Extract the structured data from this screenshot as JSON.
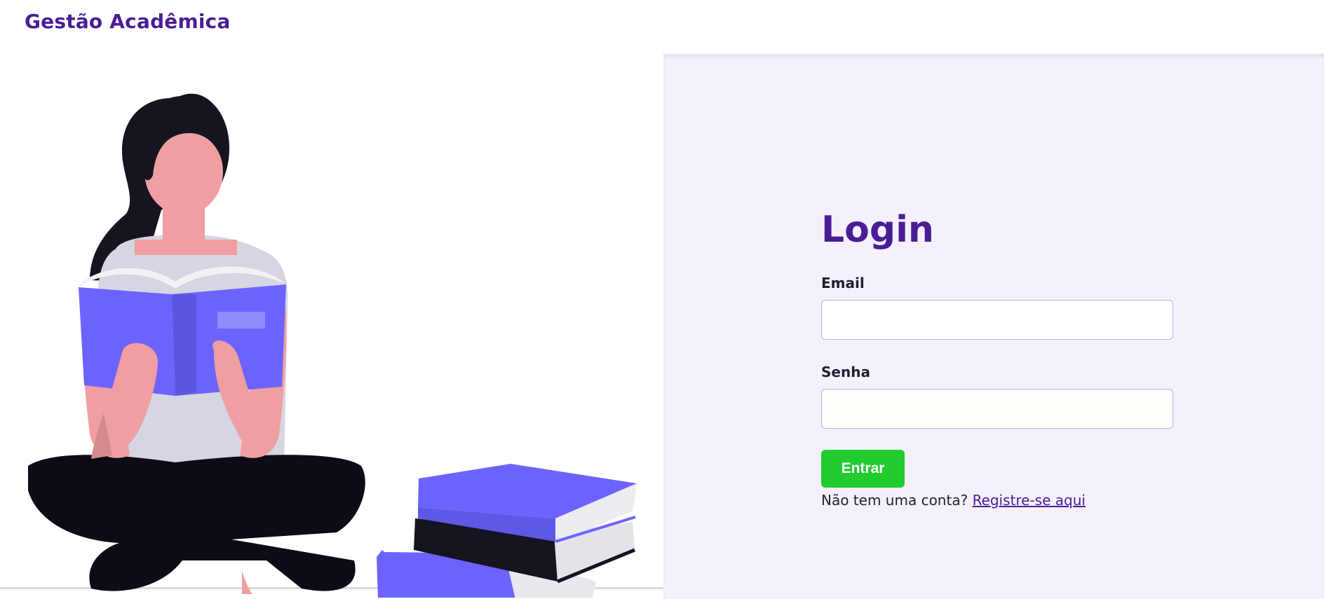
{
  "header": {
    "brand": "Gestão Acadêmica"
  },
  "illustration": {
    "subject": "woman-reading-book-with-book-stack"
  },
  "login": {
    "title": "Login",
    "email_label": "Email",
    "email_value": "",
    "password_label": "Senha",
    "password_value": "",
    "submit_label": "Entrar",
    "signup_prompt": "Não tem uma conta?",
    "signup_link": "Registre-se aqui"
  },
  "colors": {
    "brand": "#4a1d96",
    "panel_background": "#f4f1fd",
    "button": "#22cc2e",
    "accent": "#6c63ff"
  }
}
